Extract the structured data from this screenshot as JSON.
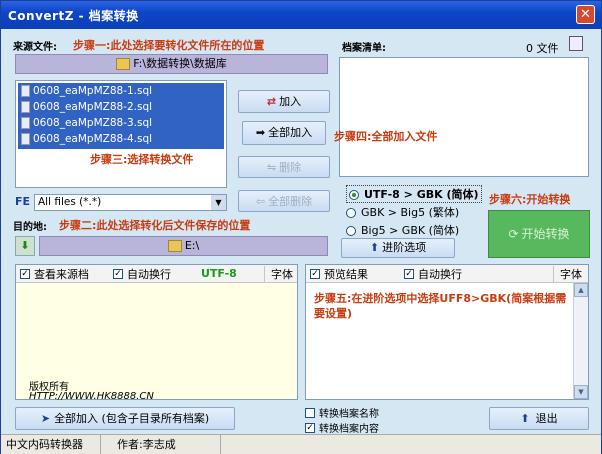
{
  "window": {
    "title": "ConvertZ - 档案转换",
    "close_label": "✕"
  },
  "source": {
    "label": "来源文件:",
    "step1": "步骤一:此处选择要转化文件所在的位置",
    "path": "F:\\数据转换\\数据库",
    "files": [
      "0608_eaMpMZ88-1.sql",
      "0608_eaMpMZ88-2.sql",
      "0608_eaMpMZ88-3.sql",
      "0608_eaMpMZ88-4.sql"
    ],
    "step3": "步骤三:选择转换文件",
    "filter_label": "FE",
    "filter_value": "All files (*.*)"
  },
  "buttons": {
    "add": "加入",
    "add_all": "全部加入",
    "delete": "删除",
    "delete_all": "全部删除",
    "advanced": "进阶选项",
    "start": "开始转换",
    "add_all_sub": "全部加入 (包含子目录所有档案)",
    "exit": "退出"
  },
  "list": {
    "label": "档案清单:",
    "count": "0 文件",
    "step4": "步骤四:全部加入文件"
  },
  "conversion": {
    "options": [
      {
        "label": "UTF-8 > GBK (简体)",
        "selected": true
      },
      {
        "label": "GBK > Big5 (繁体)",
        "selected": false
      },
      {
        "label": "Big5 > GBK (简体)",
        "selected": false
      }
    ],
    "step6": "步骤六:开始转换"
  },
  "dest": {
    "label": "目的地:",
    "step2": "步骤二:此处选择转化后文件保存的位置",
    "path": "E:\\"
  },
  "left_panel": {
    "check1": "查看来源档",
    "check2": "自动换行",
    "encoding": "UTF-8",
    "font": "字体",
    "watermark1": "版权所有",
    "watermark2": "HTTP://WWW.HK8888.CN"
  },
  "right_panel": {
    "check1": "预览结果",
    "check2": "自动换行",
    "font": "字体",
    "step5": "步骤五:在进阶选项中选择UFF8>GBK(简案根据需要设置)"
  },
  "bottom": {
    "rename_label": "转换档案名称",
    "rename_checked": false,
    "content_label": "转换档案内容",
    "content_checked": true
  },
  "status": {
    "app": "中文内码转换器",
    "author": "作者:李志成"
  }
}
